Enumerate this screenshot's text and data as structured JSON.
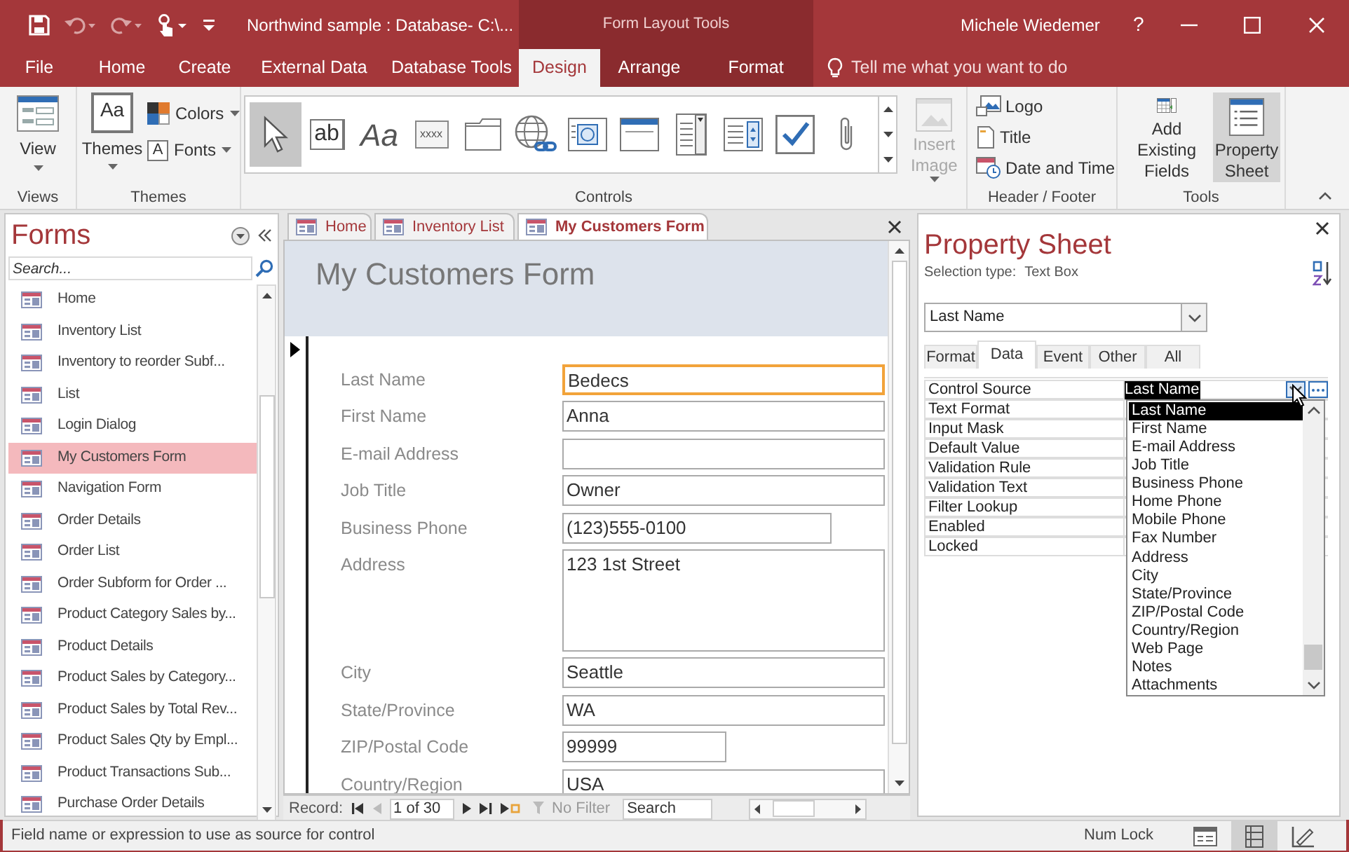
{
  "title_bar": {
    "document_title": "Northwind sample : Database- C:\\...",
    "contextual_group": "Form Layout Tools",
    "user": "Michele Wiedemer",
    "help": "?"
  },
  "ribbon_tabs": [
    {
      "label": "File",
      "selected": false,
      "contextual": false
    },
    {
      "label": "Home",
      "selected": false,
      "contextual": false
    },
    {
      "label": "Create",
      "selected": false,
      "contextual": false
    },
    {
      "label": "External Data",
      "selected": false,
      "contextual": false
    },
    {
      "label": "Database Tools",
      "selected": false,
      "contextual": false
    },
    {
      "label": "Design",
      "selected": true,
      "contextual": true
    },
    {
      "label": "Arrange",
      "selected": false,
      "contextual": true
    },
    {
      "label": "Format",
      "selected": false,
      "contextual": true
    }
  ],
  "tell_me": {
    "placeholder": "Tell me what you want to do"
  },
  "ribbon": {
    "views": {
      "label": "Views",
      "view_button": "View"
    },
    "themes": {
      "label": "Themes",
      "themes_button": "Themes",
      "themes_glyph": "Aa",
      "colors_button": "Colors",
      "fonts_button": "Fonts",
      "fonts_glyph": "A"
    },
    "controls": {
      "label": "Controls",
      "items": [
        {
          "kind": "pointer",
          "selected": true
        },
        {
          "kind": "textbox",
          "glyph": "ab",
          "selected": false
        },
        {
          "kind": "label",
          "glyph": "Aa",
          "selected": false
        },
        {
          "kind": "button",
          "glyph": "xxxx",
          "selected": false
        },
        {
          "kind": "tab",
          "selected": false
        },
        {
          "kind": "hyperlink",
          "selected": false
        },
        {
          "kind": "browser",
          "selected": false
        },
        {
          "kind": "navigation",
          "selected": false
        },
        {
          "kind": "combo",
          "selected": false
        },
        {
          "kind": "listbox",
          "selected": false
        },
        {
          "kind": "checkbox",
          "selected": false
        },
        {
          "kind": "attachment",
          "selected": false
        }
      ],
      "insert_image": {
        "label": "Insert Image",
        "disabled": true
      }
    },
    "header_footer": {
      "label": "Header / Footer",
      "items": [
        {
          "kind": "logo",
          "label": "Logo"
        },
        {
          "kind": "title",
          "label": "Title"
        },
        {
          "kind": "date_time",
          "label": "Date and Time"
        }
      ]
    },
    "tools": {
      "label": "Tools",
      "items": [
        {
          "kind": "add_fields",
          "label": "Add Existing Fields",
          "selected": false
        },
        {
          "kind": "property_sheet",
          "label": "Property Sheet",
          "selected": true
        }
      ]
    }
  },
  "navigation_pane": {
    "title": "Forms",
    "search": {
      "placeholder": "Search..."
    },
    "items": [
      {
        "label": "Home",
        "selected": false
      },
      {
        "label": "Inventory List",
        "selected": false
      },
      {
        "label": "Inventory to reorder Subf...",
        "selected": false
      },
      {
        "label": "List",
        "selected": false
      },
      {
        "label": "Login Dialog",
        "selected": false
      },
      {
        "label": "My Customers Form",
        "selected": true
      },
      {
        "label": "Navigation Form",
        "selected": false
      },
      {
        "label": "Order Details",
        "selected": false
      },
      {
        "label": "Order List",
        "selected": false
      },
      {
        "label": "Order Subform for Order ...",
        "selected": false
      },
      {
        "label": "Product Category Sales by...",
        "selected": false
      },
      {
        "label": "Product Details",
        "selected": false
      },
      {
        "label": "Product Sales by Category...",
        "selected": false
      },
      {
        "label": "Product Sales by Total Rev...",
        "selected": false
      },
      {
        "label": "Product Sales Qty by Empl...",
        "selected": false
      },
      {
        "label": "Product Transactions Sub...",
        "selected": false
      },
      {
        "label": "Purchase Order Details",
        "selected": false
      }
    ]
  },
  "document_tabs": [
    {
      "label": "Home",
      "selected": false
    },
    {
      "label": "Inventory List",
      "selected": false
    },
    {
      "label": "My Customers Form",
      "selected": true
    }
  ],
  "form": {
    "title": "My Customers Form",
    "fields": [
      {
        "label": "Last Name",
        "value": "Bedecs",
        "kind": "wide",
        "focused": true
      },
      {
        "label": "First Name",
        "value": "Anna",
        "kind": "wide",
        "focused": false
      },
      {
        "label": "E-mail Address",
        "kind": "wide",
        "focused": false
      },
      {
        "label": "Job Title",
        "value": "Owner",
        "kind": "wide",
        "focused": false
      },
      {
        "label": "Business Phone",
        "value": "(123)555-0100",
        "kind": "medium",
        "focused": false
      },
      {
        "label": "Address",
        "value": "123 1st Street",
        "kind": "memo",
        "focused": false
      },
      {
        "label": "City",
        "value": "Seattle",
        "kind": "wide",
        "focused": false
      },
      {
        "label": "State/Province",
        "value": "WA",
        "kind": "wide",
        "focused": false
      },
      {
        "label": "ZIP/Postal Code",
        "value": "99999",
        "kind": "narrow",
        "focused": false
      },
      {
        "label": "Country/Region",
        "value": "USA",
        "kind": "wide",
        "focused": false
      }
    ],
    "record_navigator": {
      "label": "Record:",
      "position": "1 of 30",
      "filter": "No Filter",
      "search": {
        "placeholder": "Search"
      }
    }
  },
  "property_sheet": {
    "title": "Property Sheet",
    "selection_type_label": "Selection type:",
    "selection_type": "Text Box",
    "object": "Last Name",
    "tabs": [
      {
        "label": "Format",
        "selected": false
      },
      {
        "label": "Data",
        "selected": true
      },
      {
        "label": "Event",
        "selected": false
      },
      {
        "label": "Other",
        "selected": false
      },
      {
        "label": "All",
        "selected": false
      }
    ],
    "properties": [
      {
        "name": "Control Source",
        "value": "Last Name"
      },
      {
        "name": "Text Format"
      },
      {
        "name": "Input Mask"
      },
      {
        "name": "Default Value"
      },
      {
        "name": "Validation Rule"
      },
      {
        "name": "Validation Text"
      },
      {
        "name": "Filter Lookup"
      },
      {
        "name": "Enabled"
      },
      {
        "name": "Locked"
      }
    ],
    "dropdown": {
      "options": [
        {
          "label": "Last Name",
          "selected": true
        },
        {
          "label": "First Name",
          "selected": false
        },
        {
          "label": "E-mail Address",
          "selected": false
        },
        {
          "label": "Job Title",
          "selected": false
        },
        {
          "label": "Business Phone",
          "selected": false
        },
        {
          "label": "Home Phone",
          "selected": false
        },
        {
          "label": "Mobile Phone",
          "selected": false
        },
        {
          "label": "Fax Number",
          "selected": false
        },
        {
          "label": "Address",
          "selected": false
        },
        {
          "label": "City",
          "selected": false
        },
        {
          "label": "State/Province",
          "selected": false
        },
        {
          "label": "ZIP/Postal Code",
          "selected": false
        },
        {
          "label": "Country/Region",
          "selected": false
        },
        {
          "label": "Web Page",
          "selected": false
        },
        {
          "label": "Notes",
          "selected": false
        },
        {
          "label": "Attachments",
          "selected": false
        }
      ]
    }
  },
  "status_bar": {
    "message": "Field name or expression to use as source for control",
    "num_lock": "Num Lock",
    "views": [
      {
        "kind": "form",
        "selected": false
      },
      {
        "kind": "layout",
        "selected": true
      },
      {
        "kind": "design",
        "selected": false
      }
    ]
  }
}
